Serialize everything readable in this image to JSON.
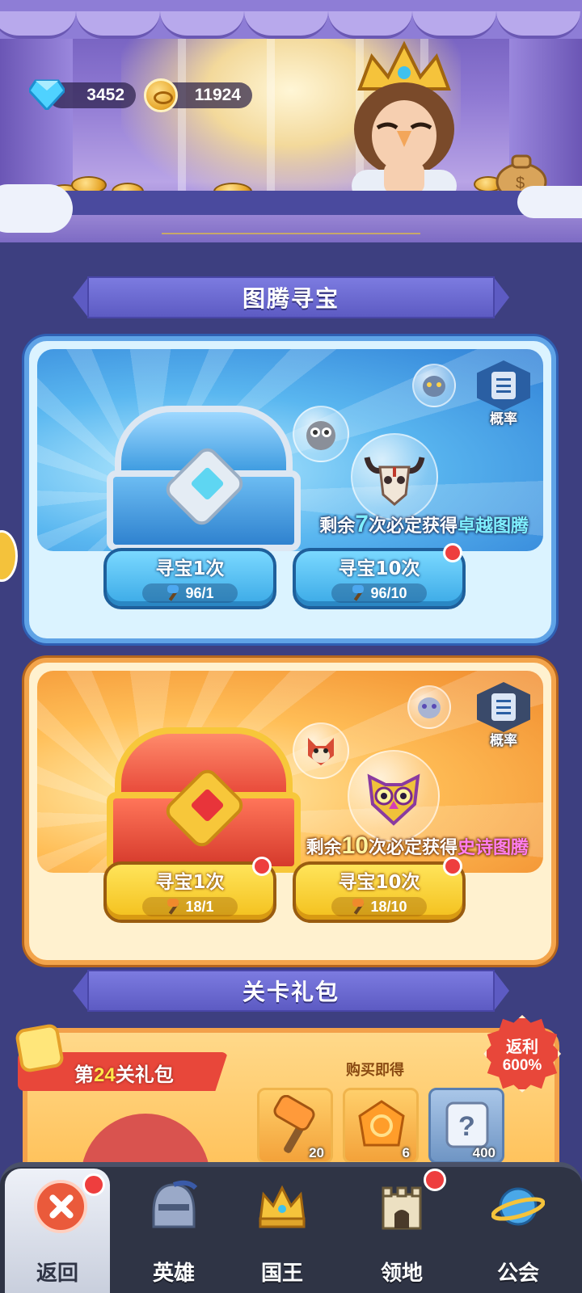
{
  "currency": {
    "gems": "3452",
    "coins": "11924"
  },
  "totem_section": {
    "title": "图腾寻宝"
  },
  "panels": [
    {
      "id": "blue",
      "prob_label": "概率",
      "guarantee_prefix": "剩余",
      "guarantee_count": "7",
      "guarantee_mid": "次必定获得",
      "guarantee_reward": "卓越图腾",
      "buttons": [
        {
          "label": "寻宝1次",
          "cost": "96/1"
        },
        {
          "label": "寻宝10次",
          "cost": "96/10"
        }
      ]
    },
    {
      "id": "gold",
      "prob_label": "概率",
      "guarantee_prefix": "剩余",
      "guarantee_count": "10",
      "guarantee_mid": "次必定获得",
      "guarantee_reward": "史诗图腾",
      "buttons": [
        {
          "label": "寻宝1次",
          "cost": "18/1"
        },
        {
          "label": "寻宝10次",
          "cost": "18/10"
        }
      ]
    }
  ],
  "stage_section": {
    "title": "关卡礼包"
  },
  "pack": {
    "tag_prefix": "第",
    "tag_level": "24",
    "tag_suffix": "关礼包",
    "buy_label": "购买即得",
    "rebate_label": "返利",
    "rebate_value": "600%",
    "items": [
      {
        "icon": "hammer-icon",
        "qty": "20"
      },
      {
        "icon": "amber-icon",
        "qty": "6"
      },
      {
        "icon": "scroll-icon",
        "qty": "400"
      }
    ]
  },
  "nav": {
    "items": [
      {
        "label": "返回",
        "icon": "close-icon"
      },
      {
        "label": "英雄",
        "icon": "helmet-icon"
      },
      {
        "label": "国王",
        "icon": "crown-icon"
      },
      {
        "label": "领地",
        "icon": "castle-icon"
      },
      {
        "label": "公会",
        "icon": "planet-icon"
      }
    ]
  }
}
